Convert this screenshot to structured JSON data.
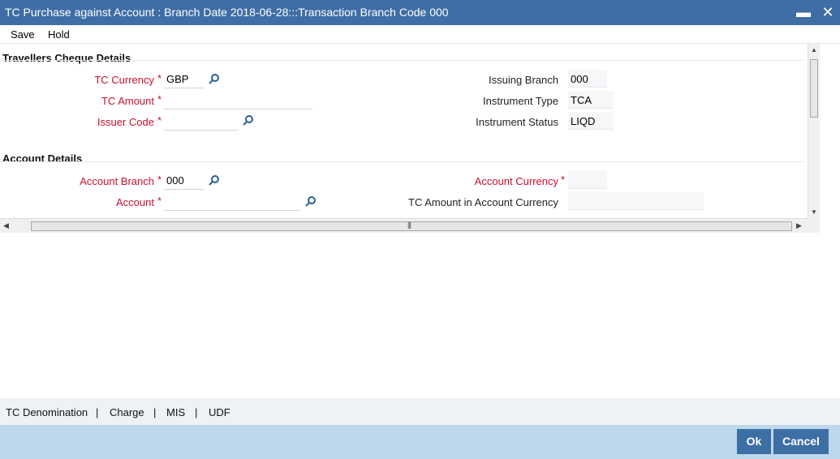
{
  "window": {
    "title": "TC Purchase against Account : Branch Date 2018-06-28:::Transaction Branch Code 000",
    "minimize_glyph": "▬",
    "close_glyph": "✕"
  },
  "menu": {
    "save": "Save",
    "hold": "Hold"
  },
  "travellers_cheque": {
    "section_title": "Travellers Cheque Details",
    "tc_currency": {
      "label": "TC Currency",
      "value": "GBP"
    },
    "tc_amount": {
      "label": "TC Amount",
      "value": ""
    },
    "issuer_code": {
      "label": "Issuer Code",
      "value": ""
    },
    "issuing_branch": {
      "label": "Issuing Branch",
      "value": "000"
    },
    "instrument_type": {
      "label": "Instrument Type",
      "value": "TCA"
    },
    "instrument_status": {
      "label": "Instrument Status",
      "value": "LIQD"
    }
  },
  "account_details": {
    "section_title": "Account Details",
    "account_branch": {
      "label": "Account Branch",
      "value": "000"
    },
    "account": {
      "label": "Account",
      "value": ""
    },
    "account_currency": {
      "label": "Account Currency",
      "value": ""
    },
    "tc_amount_acy": {
      "label": "TC Amount in Account Currency",
      "value": ""
    }
  },
  "required_marker": "*",
  "tabs": [
    "TC Denomination",
    "Charge",
    "MIS",
    "UDF"
  ],
  "tab_separator": "|",
  "footer": {
    "ok": "Ok",
    "cancel": "Cancel"
  },
  "colors": {
    "titlebar": "#3f6ea6",
    "required_label": "#c8102e",
    "footer_bg": "#bed7ea",
    "button_bg": "#3d6fa5"
  },
  "icons": {
    "lookup": "search-icon"
  }
}
